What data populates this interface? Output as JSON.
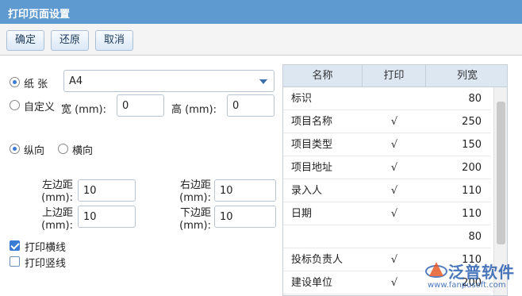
{
  "window": {
    "title": "打印页面设置"
  },
  "toolbar": {
    "confirm_label": "确定",
    "reset_label": "还原",
    "cancel_label": "取消"
  },
  "paper": {
    "paper_label": "纸 张",
    "paper_value": "A4",
    "custom_label": "自定义",
    "width_label": "宽 (mm):",
    "width_value": "0",
    "height_label": "高 (mm):",
    "height_value": "0",
    "selected": "paper"
  },
  "orientation": {
    "portrait_label": "纵向",
    "landscape_label": "横向",
    "selected": "portrait"
  },
  "margins": {
    "left_label_1": "左边距",
    "left_label_2": "(mm):",
    "left_value": "10",
    "right_label_1": "右边距",
    "right_label_2": "(mm):",
    "right_value": "10",
    "top_label_1": "上边距",
    "top_label_2": "(mm):",
    "top_value": "10",
    "bottom_label_1": "下边距",
    "bottom_label_2": "(mm):",
    "bottom_value": "10"
  },
  "options": {
    "print_hlines_label": "打印横线",
    "print_hlines_checked": true,
    "print_vlines_label": "打印竖线",
    "print_vlines_checked": false
  },
  "grid": {
    "headers": [
      "名称",
      "打印",
      "列宽"
    ],
    "rows": [
      {
        "name": "标识",
        "print": "",
        "width": "80"
      },
      {
        "name": "项目名称",
        "print": "√",
        "width": "250"
      },
      {
        "name": "项目类型",
        "print": "√",
        "width": "150"
      },
      {
        "name": "项目地址",
        "print": "√",
        "width": "200"
      },
      {
        "name": "录入人",
        "print": "√",
        "width": "110"
      },
      {
        "name": "日期",
        "print": "√",
        "width": "110"
      },
      {
        "name": "",
        "print": "",
        "width": "80"
      },
      {
        "name": "投标负责人",
        "print": "√",
        "width": "110"
      },
      {
        "name": "建设单位",
        "print": "√",
        "width": "200"
      }
    ]
  },
  "watermark": {
    "brand": "泛普软件",
    "url": "www.fanpusoft.com",
    "color": "#2a5fb0"
  }
}
